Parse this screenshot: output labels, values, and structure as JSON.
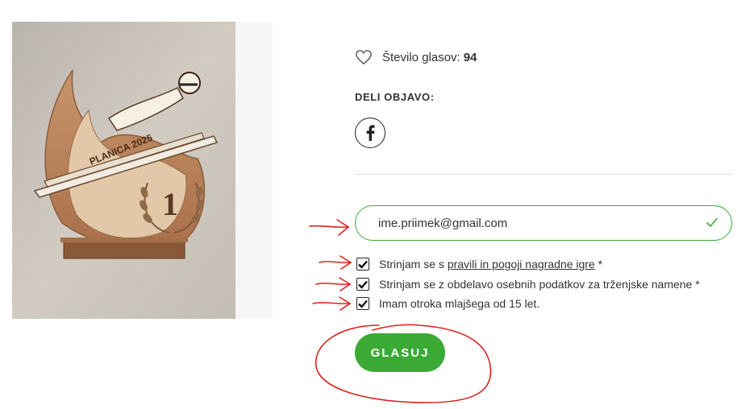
{
  "drawing": {
    "banner_text": "PLANICA 2025",
    "trophy_number": "1",
    "alt": ""
  },
  "votes": {
    "label": "Število glasov:",
    "count": "94",
    "icon": "heart-outline-icon"
  },
  "share": {
    "heading": "DELI OBJAVO:",
    "facebook_icon": "facebook-icon"
  },
  "form": {
    "email_value": "ime.priimek@gmail.com",
    "email_valid_icon": "checkmark-icon",
    "consents": [
      {
        "prefix": "Strinjam se s ",
        "link": "pravili in pogoji nagradne igre",
        "suffix": " *",
        "checked": true
      },
      {
        "prefix": "Strinjam se z obdelavo osebnih podatkov za trženjske namene *",
        "link": "",
        "suffix": "",
        "checked": true
      },
      {
        "prefix": "Imam otroka mlajšega od 15 let.",
        "link": "",
        "suffix": "",
        "checked": true
      }
    ],
    "submit_label": "GLASUJ"
  },
  "colors": {
    "accent_green": "#3aaa35",
    "annotation_red": "#e0201c"
  }
}
